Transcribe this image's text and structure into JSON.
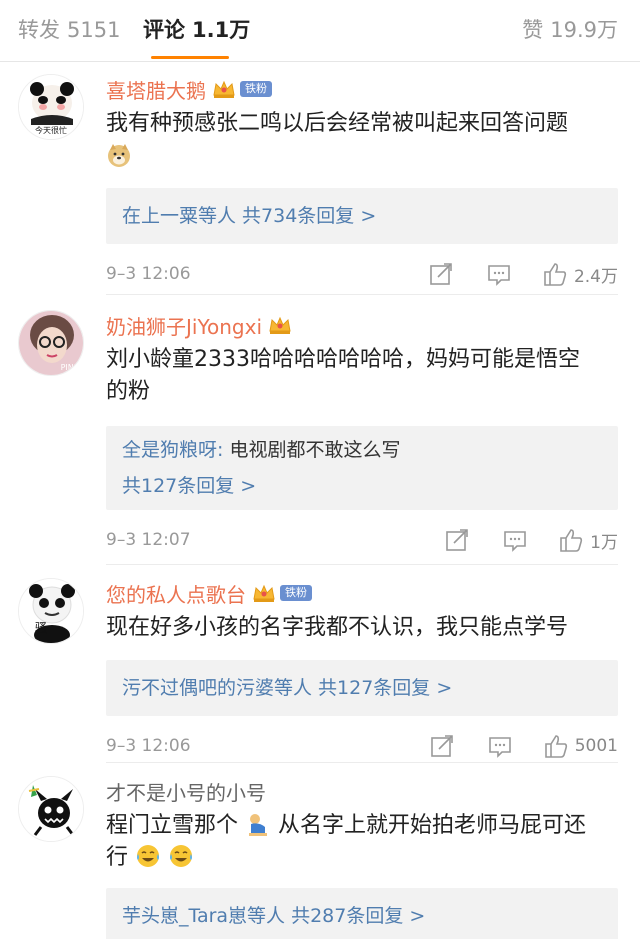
{
  "tabs": {
    "repost_label": "转发",
    "repost_count": "5151",
    "comment_label": "评论",
    "comment_count": "1.1万",
    "like_label": "赞",
    "like_count": "19.9万"
  },
  "colors": {
    "accent": "#ff8200",
    "username": "#eb7350",
    "link": "#507daf",
    "reply_bg": "#f2f2f2"
  },
  "badge_label": "铁粉",
  "comments": [
    {
      "username": "喜塔腊大鹅",
      "avatar_caption": "今天很忙",
      "text": "我有种预感张二鸣以后会经常被叫起来回答问题",
      "replies": [
        "在上一粟等人  共734条回复 >"
      ],
      "time": "9–3 12:06",
      "likes": "2.4万"
    },
    {
      "username": "奶油狮子JiYongxi",
      "avatar_caption": "PINK",
      "text_line1": "刘小龄童2333哈哈哈哈哈哈哈，妈妈可能是悟空",
      "text_line2": "的粉",
      "reply_author": "全是狗粮呀:",
      "reply_text": " 电视剧都不敢这么写",
      "reply_more": "共127条回复 >",
      "time": "9–3 12:07",
      "likes": "1万"
    },
    {
      "username": "您的私人点歌台",
      "avatar_caption": "骚",
      "text": "现在好多小孩的名字我都不认识，我只能点学号",
      "replies": [
        "污不过偶吧的污婆等人  共127条回复 >"
      ],
      "time": "9–3 12:06",
      "likes": "5001"
    },
    {
      "username": "才不是小号的小号",
      "text_part1": "程门立雪那个",
      "text_part2": "从名字上就开始拍老师马屁可还",
      "text_line2": "行",
      "replies": [
        "芋头崽_Tara崽等人  共287条回复 >"
      ]
    }
  ]
}
